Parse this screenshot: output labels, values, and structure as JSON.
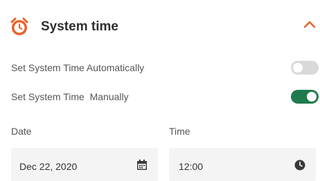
{
  "header": {
    "title": "System time",
    "icon": "alarm-clock-icon",
    "collapse_icon": "chevron-up-icon",
    "accent_color": "#e8622a"
  },
  "options": [
    {
      "label": "Set System Time Automatically",
      "enabled": false
    },
    {
      "label": "Set System Time  Manually",
      "enabled": true
    }
  ],
  "colors": {
    "toggle_on": "#1f7a4d",
    "toggle_off": "#d9d9d9"
  },
  "date": {
    "label": "Date",
    "value": "Dec 22, 2020",
    "icon": "calendar-icon"
  },
  "time": {
    "label": "Time",
    "value": "12:00",
    "icon": "clock-icon"
  }
}
